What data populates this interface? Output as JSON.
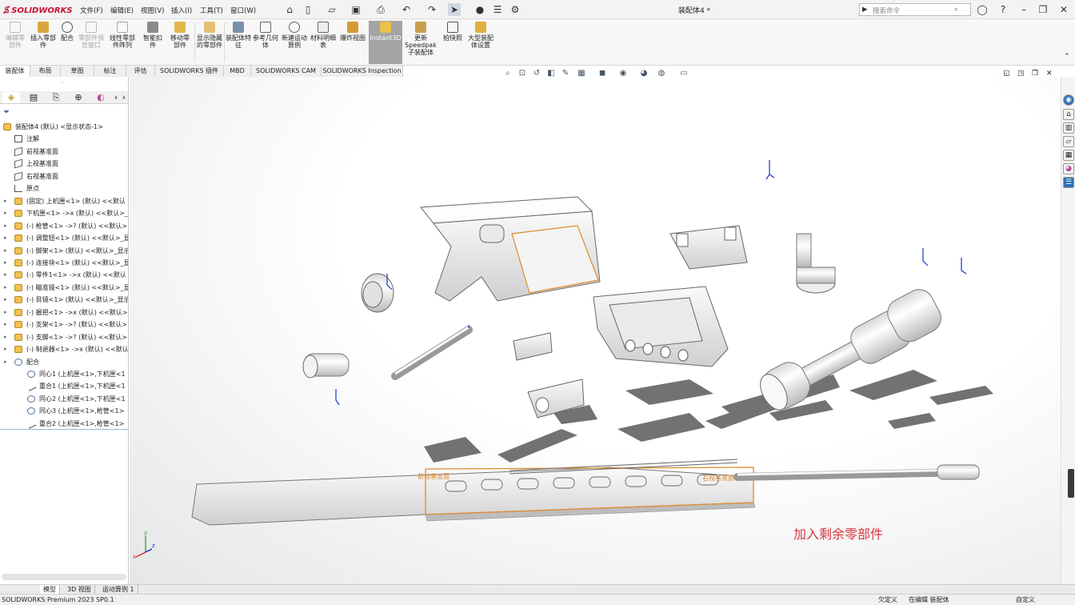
{
  "app": {
    "logo_text": "SOLIDWORKS",
    "doc_title": "装配体4 *"
  },
  "menus": [
    "文件(F)",
    "编辑(E)",
    "视图(V)",
    "插入(I)",
    "工具(T)",
    "窗口(W)"
  ],
  "search": {
    "placeholder": "搜索命令"
  },
  "ribbon": [
    {
      "label": "编辑零部件",
      "disabled": true
    },
    {
      "label": "插入零部件",
      "disabled": false
    },
    {
      "label": "配合",
      "disabled": false
    },
    {
      "label": "零部件预览窗口",
      "disabled": true
    },
    {
      "label": "线性零部件阵列",
      "disabled": false
    },
    {
      "label": "智能扣件",
      "disabled": false
    },
    {
      "label": "移动零部件",
      "disabled": false
    },
    {
      "label": "显示隐藏的零部件",
      "disabled": false
    },
    {
      "label": "装配体特征",
      "disabled": false
    },
    {
      "label": "参考几何体",
      "disabled": false
    },
    {
      "label": "新建运动算例",
      "disabled": false
    },
    {
      "label": "材料明细表",
      "disabled": false
    },
    {
      "label": "爆炸视图",
      "disabled": false
    },
    {
      "label": "Instant3D",
      "disabled": false,
      "active": true
    },
    {
      "label": "更新Speedpak子装配体",
      "disabled": false
    },
    {
      "label": "拍快照",
      "disabled": false
    },
    {
      "label": "大型装配体设置",
      "disabled": false
    }
  ],
  "command_tabs": [
    "装配体",
    "布局",
    "草图",
    "标注",
    "评估",
    "SOLIDWORKS 插件",
    "MBD",
    "SOLIDWORKS CAM",
    "SOLIDWORKS Inspection"
  ],
  "tree": {
    "root": "装配体4 (默认) <显示状态-1>",
    "items": [
      {
        "label": "注解",
        "icon": "note",
        "expand": false,
        "indent": 18
      },
      {
        "label": "前视基准面",
        "icon": "plane",
        "expand": false,
        "indent": 18
      },
      {
        "label": "上视基准面",
        "icon": "plane",
        "expand": false,
        "indent": 18
      },
      {
        "label": "右视基准面",
        "icon": "plane",
        "expand": false,
        "indent": 18
      },
      {
        "label": "原点",
        "icon": "origin",
        "expand": false,
        "indent": 18
      },
      {
        "label": "(固定) 上机匣<1> (默认) <<默认",
        "icon": "part",
        "expand": true,
        "indent": 18
      },
      {
        "label": "下机匣<1> ->x (默认) <<默认>_",
        "icon": "part",
        "expand": true,
        "indent": 18
      },
      {
        "label": "(-) 枪管<1> ->? (默认) <<默认>",
        "icon": "part",
        "expand": true,
        "indent": 18
      },
      {
        "label": "(-) 调整钮<1> (默认) <<默认>_显",
        "icon": "part",
        "expand": true,
        "indent": 18
      },
      {
        "label": "(-) 脚架<1> (默认) <<默认>_显示",
        "icon": "part",
        "expand": true,
        "indent": 18
      },
      {
        "label": "(-) 连接块<1> (默认) <<默认>_显",
        "icon": "part",
        "expand": true,
        "indent": 18
      },
      {
        "label": "(-) 零件1<1> ->x (默认) <<默认",
        "icon": "part",
        "expand": true,
        "indent": 18
      },
      {
        "label": "(-) 瞄准镜<1> (默认) <<默认>_显",
        "icon": "part",
        "expand": true,
        "indent": 18
      },
      {
        "label": "(-) 目镜<1> (默认) <<默认>_显示",
        "icon": "part",
        "expand": true,
        "indent": 18
      },
      {
        "label": "(-) 握把<1> ->x (默认) <<默认>",
        "icon": "part",
        "expand": true,
        "indent": 18
      },
      {
        "label": "(-) 支架<1> ->? (默认) <<默认>",
        "icon": "part",
        "expand": true,
        "indent": 18
      },
      {
        "label": "(-) 支脚<1> ->? (默认) <<默认>",
        "icon": "part",
        "expand": true,
        "indent": 18
      },
      {
        "label": "(-) 制退器<1> ->x (默认) <<默认",
        "icon": "part",
        "expand": true,
        "indent": 18
      },
      {
        "label": "配合",
        "icon": "mates",
        "expand": true,
        "indent": 18
      },
      {
        "label": "同心1 (上机匣<1>,下机匣<1",
        "icon": "mate",
        "expand": false,
        "indent": 34
      },
      {
        "label": "重合1 (上机匣<1>,下机匣<1",
        "icon": "coin",
        "expand": false,
        "indent": 34
      },
      {
        "label": "同心2 (上机匣<1>,下机匣<1",
        "icon": "mate",
        "expand": false,
        "indent": 34
      },
      {
        "label": "同心3 (上机匣<1>,枪管<1>",
        "icon": "mate",
        "expand": false,
        "indent": 34
      },
      {
        "label": "重合2 (上机匣<1>,枪管<1>",
        "icon": "coin",
        "expand": false,
        "indent": 34
      }
    ]
  },
  "viewport": {
    "caption": "加入剩余零部件",
    "label_front": "前视基准面",
    "label_right": "右视基准面",
    "triad": {
      "x": "x",
      "y": "y",
      "z": "z"
    }
  },
  "bottom_tabs": [
    "模型",
    "3D 视图",
    "运动算例 1"
  ],
  "status": {
    "left": "SOLIDWORKS Premium 2023 SP0.1",
    "custom": "欠定义",
    "editing": "在编辑 装配体",
    "units": "自定义"
  },
  "colors": {
    "accent": "#c8102e",
    "caption": "#d9363e",
    "highlight": "#e08a2c"
  }
}
